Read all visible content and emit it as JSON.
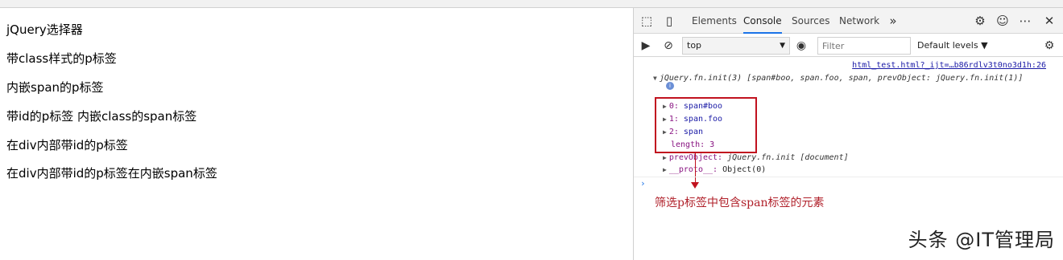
{
  "page": {
    "lines": [
      "jQuery选择器",
      "带class样式的p标签",
      "内嵌span的p标签",
      "带id的p标签 内嵌class的span标签",
      "在div内部带id的p标签",
      "在div内部带id的p标签在内嵌span标签"
    ]
  },
  "devtools": {
    "tabs": [
      "Elements",
      "Console",
      "Sources",
      "Network"
    ],
    "active_tab": "Console",
    "toolbar": {
      "context": "top",
      "filter_placeholder": "Filter",
      "levels": "Default levels ▼"
    },
    "console": {
      "source_link": "html_test.html?_ijt=…b86rdlv3t0no3d1h:26",
      "summary": "jQuery.fn.init(3) [span#boo, span.foo, span, prevObject: jQuery.fn.init(1)]",
      "entries": [
        {
          "key": "0",
          "value": "span#boo"
        },
        {
          "key": "1",
          "value": "span.foo"
        },
        {
          "key": "2",
          "value": "span"
        }
      ],
      "length_line": "length: 3",
      "prev_key": "prevObject",
      "prev_value": "jQuery.fn.init [document]",
      "proto_key": "__proto__",
      "proto_value": "Object(0)",
      "info_glyph": "i",
      "prompt": "›"
    }
  },
  "annotation": "筛选p标签中包含span标签的元素",
  "watermark": "头条 @IT管理局",
  "colors": {
    "highlight": "#c1121f",
    "accent": "#1a73e8"
  }
}
